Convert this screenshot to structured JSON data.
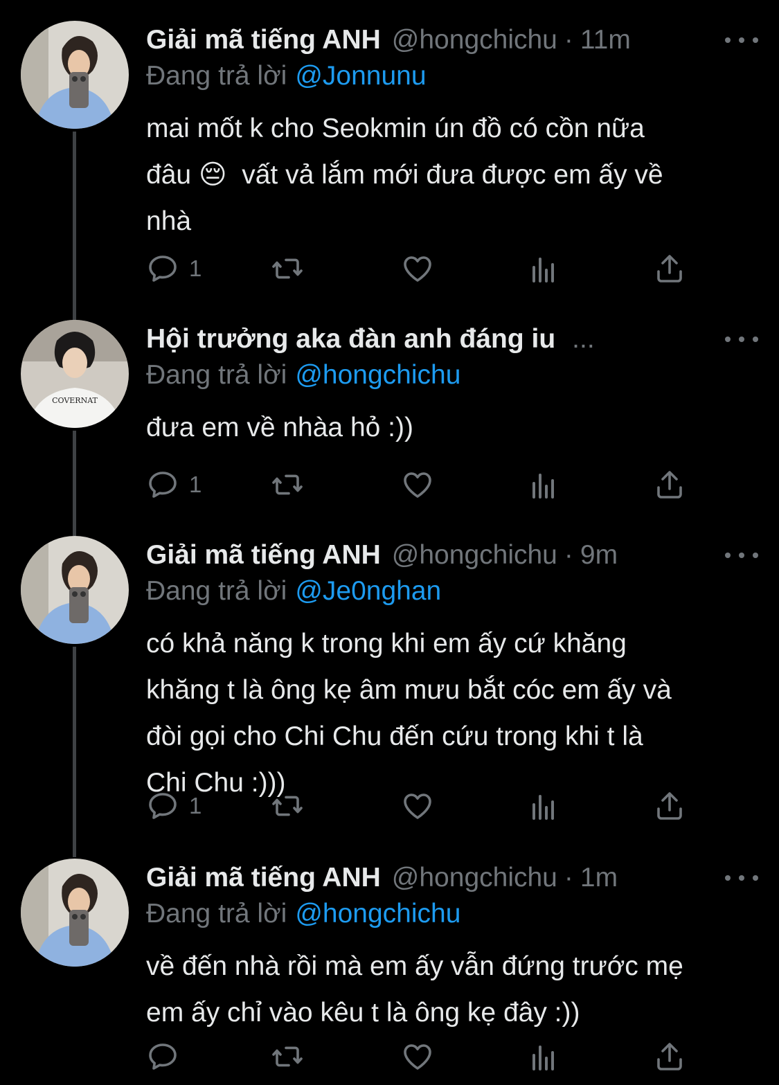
{
  "tweets": [
    {
      "name": "Giải mã tiếng ANH",
      "handle": "@hongchichu",
      "dot": "·",
      "time": "11m",
      "replying_prefix": "Đang trả lời",
      "replying_to": "@Jonnunu",
      "text": "mai mốt k cho Seokmin ún đồ có cồn nữa\nđâu 😔  vất vả lắm mới đưa được em ấy về\nnhà",
      "reply_count": "1",
      "avatar": "hongchichu-avatar"
    },
    {
      "name": "Hội trưởng aka đàn anh đáng iu",
      "ellipsis": "...",
      "replying_prefix": "Đang trả lời",
      "replying_to": "@hongchichu",
      "text": "đưa em về nhàa hỏ :))",
      "reply_count": "1",
      "avatar": "hoi-truong-avatar",
      "avatar_shirt_text": "COVERNAT"
    },
    {
      "name": "Giải mã tiếng ANH",
      "handle": "@hongchichu",
      "dot": "·",
      "time": "9m",
      "replying_prefix": "Đang trả lời",
      "replying_to": "@Je0nghan",
      "text": "có khả năng k trong khi em ấy cứ khăng\nkhăng t là ông kẹ âm mưu bắt cóc em ấy và\nđòi gọi cho Chi Chu đến cứu trong khi t là\nChi Chu :)))",
      "reply_count": "1",
      "avatar": "hongchichu-avatar"
    },
    {
      "name": "Giải mã tiếng ANH",
      "handle": "@hongchichu",
      "dot": "·",
      "time": "1m",
      "replying_prefix": "Đang trả lời",
      "replying_to": "@hongchichu",
      "text": "về đến nhà rồi mà em ấy vẫn đứng trước mẹ\nem ấy chỉ vào kêu t là ông kẹ đây :))",
      "avatar": "hongchichu-avatar"
    }
  ],
  "icons": {
    "reply": "reply-icon",
    "retweet": "retweet-icon",
    "like": "heart-icon",
    "views": "analytics-icon",
    "share": "share-icon",
    "more": "more-icon"
  },
  "colors": {
    "background": "#000000",
    "text": "#e7e9ea",
    "secondary": "#71767b",
    "mention": "#1d9bf0",
    "thread_line": "#3e4144"
  }
}
